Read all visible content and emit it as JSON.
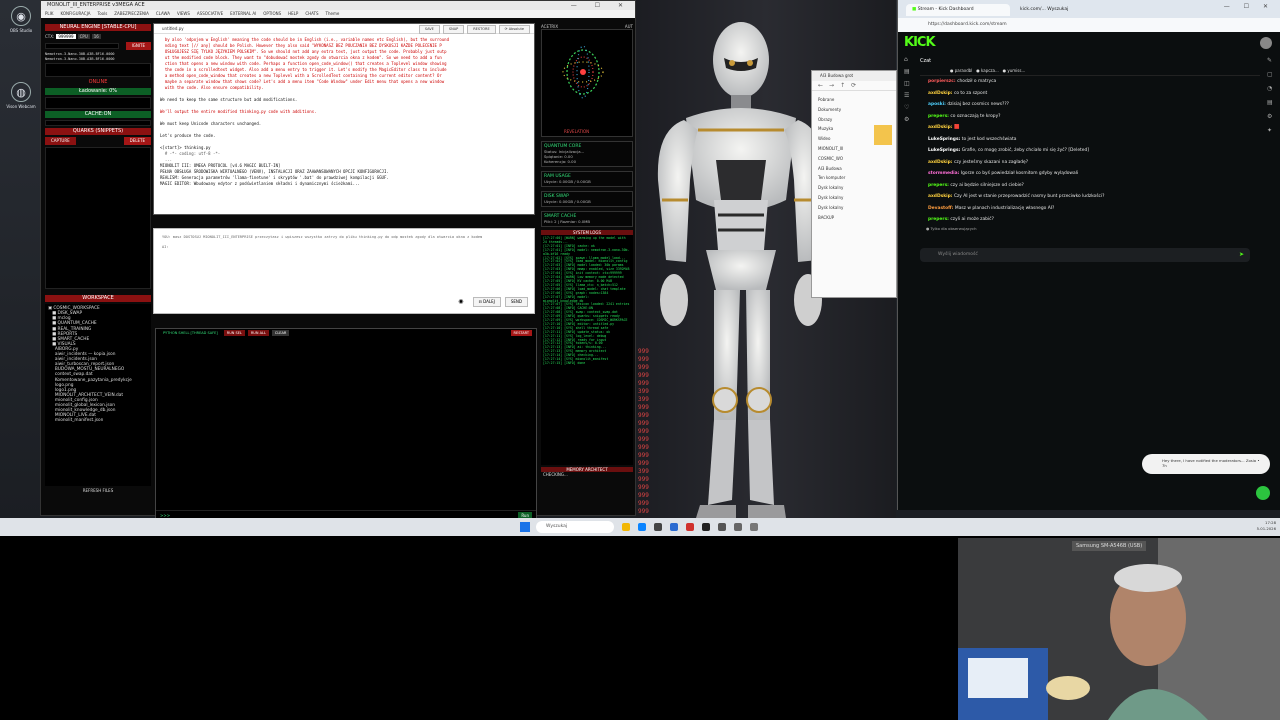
{
  "desktop": {
    "icons": [
      {
        "name": "obs-icon",
        "label": "OBS Studio",
        "glyph": "◉"
      },
      {
        "name": "webcam-icon",
        "label": "Vison Webcam",
        "glyph": "◍"
      }
    ]
  },
  "app": {
    "title": "MONOLIT_III_ENTERPRISE v3MEGA ACE",
    "menu": [
      "PLIK",
      "KONFIGURACJA",
      "Tools",
      "ZABEZPIECZENIA",
      "CLAWA",
      "VIEWS",
      "ASSOCIATIVE",
      "EXTERNAL AI",
      "OPTIONS",
      "HELP",
      "CHATS",
      "Theme"
    ],
    "left": {
      "engine_title": "NEURAL ENGINE [STABLE-CPU]",
      "ctx_label": "CTX:",
      "ctx_value": "999999",
      "cpu_label": "CPU",
      "bit_label": "16",
      "ignite_label": "IGNITE",
      "models": [
        "Nemotron-3-Nano-30B-A3B-BF16-0000",
        "Nemotron-3-Nano-30B-A3B-BF16-0000"
      ],
      "online_label": "ONLINE",
      "ladowanie": "Ładowanie: 0%",
      "cache_label": "CACHE:ON",
      "quarks_title": "QUARKS (SNIPPETS)",
      "capture_label": "CAPTURE",
      "delete_label": "DELETE",
      "workspace_title": "WORKSPACE",
      "refresh_label": "REFRESH FILES",
      "tree": [
        "▣ COSMIC_WORKSPACE",
        "   ■ DISK_SWAP",
        "   ■ mclog",
        "   ■ QUANTUM_CACHE",
        "   ■ REAL_TRAINING",
        "   ■ REPORTS",
        "   ■ SMART_CACHE",
        "   ■ VISUALS",
        "     AIBORG.py",
        "     aiwir_incidents — kopia.json",
        "     aiwir_incidents.json",
        "     aiwir_turboscan_report.json",
        "     BUDOWA_MOSTU_NEURALNEGO",
        "     context_swap.dat",
        "     Komentowane_pazytania_predykcje",
        "     logo.png",
        "     logo1.png",
        "     MIONOLIT_ARCHITECT_VEIN.dat",
        "     mionolit_config.json",
        "     mionolit_global_lexicon.json",
        "     mionolit_knowledge_db.json",
        "     MIONOLIT_LIVE.dat",
        "     mionolit_manifest.json"
      ]
    },
    "editor": {
      "filename": "untitled.py",
      "buttons": [
        "SAVE",
        "SNAP",
        "RESTORE",
        "⟳ Absolute"
      ],
      "lines": [
        {
          "t": "  by also 'odpojem w English' meaning the code should be in English (i.e., variable names etc English), but the surround",
          "c": "red"
        },
        {
          "t": "  nding text [// any] should be Polish. However they also said \"WYKONASZ BEZ POUCZANIA BEZ DYSKUSJI KAŻDE POLECENIE P",
          "c": "red"
        },
        {
          "t": "  OSŁUGUJESZ SIĘ TYLKO JĘZYKIEM POLSKIM\". So we should not add any extra text, just output the code. Probably just outp",
          "c": "red"
        },
        {
          "t": "  ut the modified code block. They want to \"dobudować mostek zgody do otwarcia okna z kodem\". So we need to add a fun",
          "c": "red"
        },
        {
          "t": "  ction that opens a new window with code. Perhaps a function open_code_window() that creates a Toplevel window showing",
          "c": "red"
        },
        {
          "t": "  the code in a scrolledtext widget. Also add a menu entry to trigger it. Let's modify the MagicEditor class to include",
          "c": "red"
        },
        {
          "t": "  a method open_code_window that creates a new Toplevel with a ScrolledText containing the current editor content? Or",
          "c": "red"
        },
        {
          "t": "  maybe a separate window that shows code? Let's add a menu item \"Code Window\" under Edit menu that opens a new window",
          "c": "red"
        },
        {
          "t": "  with the code. Also ensure compatibility.",
          "c": "red"
        },
        {
          "t": "",
          "c": ""
        },
        {
          "t": "We need to keep the same structure but add modifications.",
          "c": ""
        },
        {
          "t": "",
          "c": ""
        },
        {
          "t": "We'll output the entire modified thinking.py code with additions.",
          "c": "red"
        },
        {
          "t": "",
          "c": ""
        },
        {
          "t": "We must keep Unicode characters unchanged.",
          "c": ""
        },
        {
          "t": "",
          "c": ""
        },
        {
          "t": "Let's produce the code.",
          "c": ""
        },
        {
          "t": "",
          "c": ""
        },
        {
          "t": "<[start]> thinking.py",
          "c": ""
        },
        {
          "t": "  # -*- coding: utf-8 -*-",
          "c": "muted"
        },
        {
          "t": "  ...",
          "c": "muted"
        },
        {
          "t": "MIONOLIT III: OMEGA PROTOCOL [v4.6 MAGIC BUILT-IN]",
          "c": ""
        },
        {
          "t": "PEŁNA OBSŁUGA ŚRODOWISKA WIRTUALNEGO (VENV), INSTALACJI ORAZ ZAAWANSOWANYCH OPCJI KONFIGURACJI.",
          "c": ""
        },
        {
          "t": "REALISM: Generacja parametrów 'llama-finetune' i skryptów '.bat' do prawdziwej kompilacji GGUF.",
          "c": ""
        },
        {
          "t": "MAGIC EDITOR: Wbudowany edytor z podświetlaniem składni i dynamicznymi ścieżkami...",
          "c": ""
        }
      ]
    },
    "chat": {
      "input_text": "YOU: masz DOSTOSUJ MIONOLIT_III_ENTERPRISE przeczytasz i wpiszesz wszystko zatrzy do pliku thinking.py do odp mostek zgody dla otwarcia okna z kodem",
      "input_text2": "AI:",
      "stop_glyph": "◉",
      "attach_label": "⊟ DALEJ",
      "send_label": "SEND"
    },
    "shell": {
      "title": "PYTHON SHELL [THREAD SAFE]",
      "buttons": [
        "RUN SEL",
        "RUN ALL",
        "CLEAR"
      ],
      "restart_label": "RESTART",
      "prompt": ">>>",
      "run_label": "Run"
    },
    "right": {
      "acetrix_label": "ACETRIX",
      "aut_label": "AUT",
      "revelation_label": "REVELATION",
      "quantum_title": "QUANTUM CORE",
      "quantum_lines": [
        "Status: Inicjalizacja...",
        "Splątanie: 0.00",
        "Koherencja: 0.00"
      ],
      "ram_title": "RAM USAGE",
      "ram_lines": [
        "Użycie: 0.00GB / 0.00GB"
      ],
      "disk_title": "DISK SWAP",
      "disk_lines": [
        "Użycie: 0.00GB / 0.00GB"
      ],
      "cache_title": "SMART CACHE",
      "cache_lines": [
        "Pliki: 2 | Rozmiar: 0.0MB"
      ],
      "log_title": "SYSTEM LOGS",
      "log_lines": [
        "[17:27:00] [WARN] warming up the model with 24 threads...",
        "[17:27:01] [INFO] cache: ok",
        "[17:27:01] [INFO] model: nemotron-3-nano-30b-a3b-bf16 ready",
        "[17:27:02] [SYS] spawn: llama_model_load...",
        "[17:27:02] [SYS] load_model: mionolit_config",
        "[17:27:03] [INFO] model loaded: 30b params",
        "[17:27:03] [INFO] mmap: enabled, size 3392MiB",
        "[17:27:04] [SYS] init context: ctx=999999",
        "[17:27:04] [WARN] Low memory mode detected",
        "[17:27:05] [INFO] KV cache: 0.00 MiB",
        "[17:27:05] [SYS] llama_ctx: n_batch=512",
        "[17:27:06] [INFO] load_model: chat template",
        "[17:27:06] [SYS] graph: nodes=1384",
        "[17:27:07] [INFO] model: mionolit_knowledge_db",
        "[17:27:07] [SYS] lexicon loaded: 2241 entries",
        "[17:27:08] [INFO] CACHE:ON",
        "[17:27:08] [SYS] swap: context_swap.dat",
        "[17:27:09] [INFO] quarks: snippets ready",
        "[17:27:09] [SYS] workspace: COSMIC_WORKSPACE",
        "[17:27:10] [INFO] editor: untitled.py",
        "[17:27:10] [SYS] shell thread safe",
        "[17:27:11] [INFO] update_status: ok",
        "[17:27:11] [SYS] log_level: debug",
        "[17:27:12] [INFO] ready for input",
        "[17:27:12] [SYS] tokens/s: 0.00",
        "[17:27:13] [INFO] ai: thinking...",
        "[17:27:13] [SYS] memory architect",
        "[17:27:14] [INFO] checking...",
        "[17:27:14] [SYS] mionolit_manifest",
        "[17:27:15] [INFO] done"
      ],
      "memory_title": "MEMORY ARCHITECT",
      "memory_status": "CHECKING..."
    }
  },
  "explorer": {
    "title": "AI3 Budowa grot",
    "items": [
      "Pobrane",
      "Dokumenty",
      "Obrazy",
      "Muzyka",
      "Wideo",
      "MIONOLIT_III",
      "COSMIC_WO",
      "AI3 Budowa",
      "Ten komputer",
      "Dysk lokalny",
      "Dysk lokalny",
      "Dysk lokalny",
      "BACKUP"
    ]
  },
  "numcol": [
    "999",
    "999",
    "999",
    "999",
    "999",
    "399",
    "399",
    "999",
    "999",
    "999",
    "999",
    "999",
    "999",
    "999",
    "999",
    "399",
    "999",
    "999",
    "999",
    "999",
    "999"
  ],
  "browser": {
    "tab1": "Stream - Kick Dashboard",
    "tab2": "kick.com/... Wyszukaj",
    "url": "https://dashboard.kick.com/stream",
    "kick_logo": "KICK",
    "chat_title": "Czat",
    "pinned": [
      "● paraxdbl",
      "● kapcza...",
      "● yumiss..."
    ],
    "messages": [
      {
        "user": "porpierszc:",
        "text": "chodził o matryca",
        "color": "#ff5b5b"
      },
      {
        "user": "axdDskip:",
        "text": "co to za szpont",
        "color": "#ffd23f"
      },
      {
        "user": "aposki:",
        "text": "dzisiaj bez cosmics news???",
        "color": "#4fd1ff"
      },
      {
        "user": "prepers:",
        "text": "co oznaczają te kropy?",
        "color": "#53fc18"
      },
      {
        "user": "axdDskip:",
        "text": "🟥",
        "color": "#ffd23f"
      },
      {
        "user": "LukeSprings:",
        "text": "to jest kod wszechświata",
        "color": "#ffffff"
      },
      {
        "user": "LukeSprings:",
        "text": "Grafie, co mogę zrobić, żeby chciało mi się żyć? [Deleted]",
        "color": "#ffffff"
      },
      {
        "user": "axdDskip:",
        "text": "czy jesteśmy skazani na zagładę?",
        "color": "#ffd23f"
      },
      {
        "user": "stormmedia:",
        "text": "Igorze co byś powiedział kosmitom gdyby wylądowali",
        "color": "#ff6fd8"
      },
      {
        "user": "prepers:",
        "text": "czy ai będzie silniejsze od ciebie?",
        "color": "#53fc18"
      },
      {
        "user": "axdDskip:",
        "text": "Czy AI jest w stanie przeprowadzić nasmy bunt przeciwko ludzkości?",
        "color": "#ffd23f"
      },
      {
        "user": "Devastoff:",
        "text": "Masz w planach industrializację własnego AI?",
        "color": "#ff9d3f"
      },
      {
        "user": "prepers:",
        "text": "czyli ai może zabić?",
        "color": "#53fc18"
      }
    ],
    "mods_only": "● Tylko dla obserwujących",
    "send_placeholder": "Wyślij wiadomość",
    "toast": "Hey there, I have notified the moderators... Zosia • 7h"
  },
  "taskbar": {
    "search_placeholder": "Wyszukaj",
    "time": "17:28",
    "date": "5.01.2026"
  },
  "webcam": {
    "label": "Samsung SM-A546B (USB)"
  }
}
